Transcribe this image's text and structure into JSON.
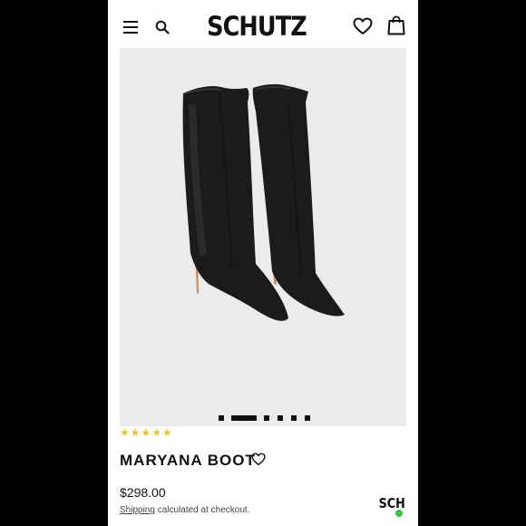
{
  "header": {
    "brand": "SCHUTZ",
    "icons": [
      "menu-icon",
      "search-icon",
      "heart-icon",
      "shopping-bag-icon"
    ]
  },
  "gallery": {
    "image": "black croc-embossed knee-high stiletto boots",
    "active_slide": 2,
    "slide_count": 6
  },
  "product": {
    "rating_stars": "★★★★★",
    "rating": 5,
    "name": "MARYANA BOOT",
    "price": "$298.00",
    "shipping_link": "Shipping",
    "shipping_note": "calculated at checkout."
  },
  "chat_badge": {
    "label": "SCH",
    "status_color": "#2ec84a"
  },
  "colors": {
    "background": "#000000",
    "stars": "#f2c318",
    "text": "#111111"
  }
}
